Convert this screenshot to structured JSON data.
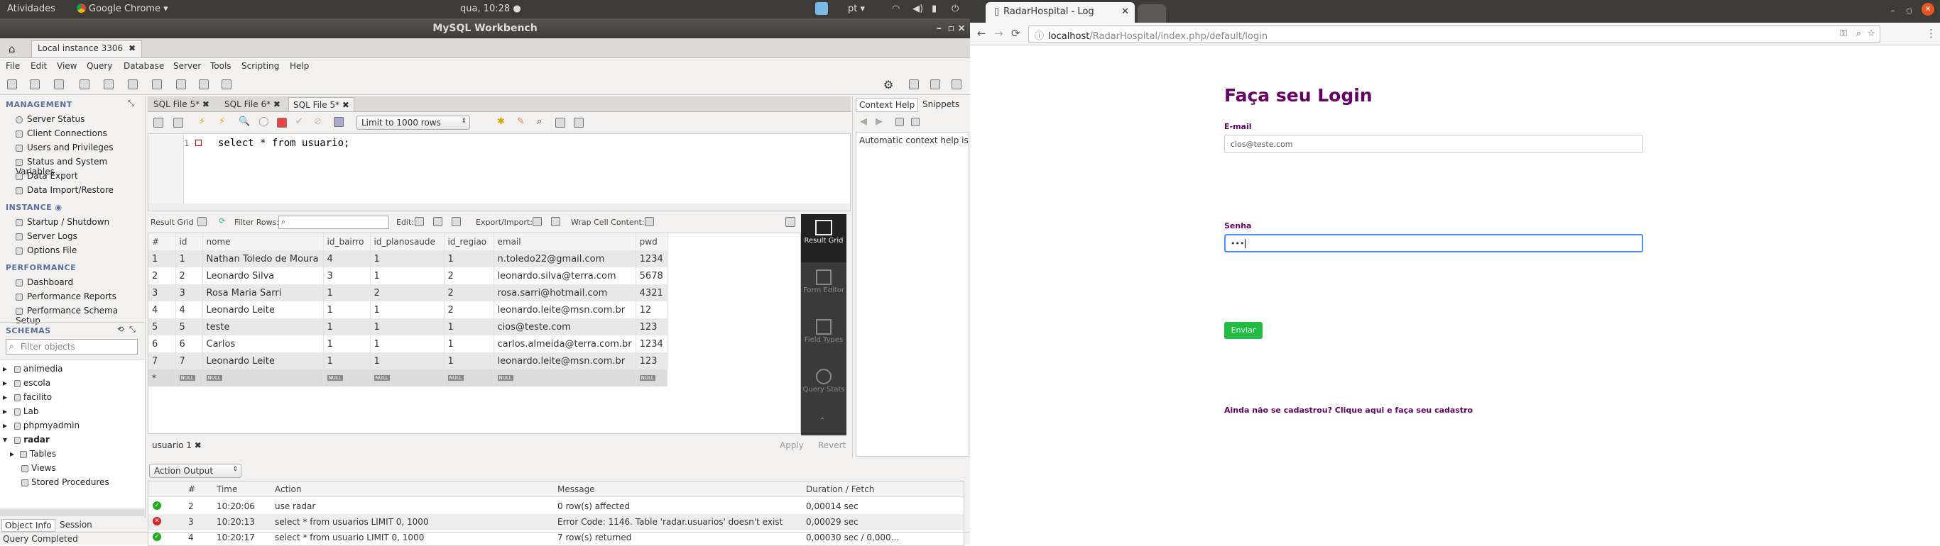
{
  "topbar": {
    "activities": "Atividades",
    "app": "Google Chrome ▾",
    "clock": "qua, 10:28 ●",
    "lang": "pt ▾"
  },
  "workbench": {
    "title": "MySQL Workbench",
    "conn_tab": "Local instance 3306",
    "menu": [
      "File",
      "Edit",
      "View",
      "Query",
      "Database",
      "Server",
      "Tools",
      "Scripting",
      "Help"
    ],
    "management": {
      "header": "MANAGEMENT",
      "items": [
        "Server Status",
        "Client Connections",
        "Users and Privileges",
        "Status and System Variables",
        "Data Export",
        "Data Import/Restore"
      ]
    },
    "instance": {
      "header": "INSTANCE",
      "items": [
        "Startup / Shutdown",
        "Server Logs",
        "Options File"
      ]
    },
    "performance": {
      "header": "PERFORMANCE",
      "items": [
        "Dashboard",
        "Performance Reports",
        "Performance Schema Setup"
      ]
    },
    "schemas": {
      "header": "SCHEMAS",
      "filter_placeholder": "Filter objects",
      "list": [
        "animedia",
        "escola",
        "facilito",
        "Lab",
        "phpmyadmin",
        "radar"
      ],
      "radar_children": [
        "Tables",
        "Views",
        "Stored Procedures"
      ]
    },
    "sql_tabs": [
      "SQL File 5*",
      "SQL File 6*",
      "SQL File 5*"
    ],
    "limit": "Limit to 1000 rows",
    "query": {
      "line": "1",
      "text": "select * from usuario;"
    },
    "result_toolbar": {
      "result_grid": "Result Grid",
      "filter_rows": "Filter Rows:",
      "edit": "Edit:",
      "export": "Export/Import:",
      "wrap": "Wrap Cell Content:"
    },
    "columns": [
      "#",
      "id",
      "nome",
      "id_bairro",
      "id_planosaude",
      "id_regiao",
      "email",
      "pwd"
    ],
    "rows": [
      [
        "1",
        "1",
        "Nathan Toledo de Moura",
        "4",
        "1",
        "1",
        "n.toledo22@gmail.com",
        "1234"
      ],
      [
        "2",
        "2",
        "Leonardo Silva",
        "3",
        "1",
        "2",
        "leonardo.silva@terra.com",
        "5678"
      ],
      [
        "3",
        "3",
        "Rosa Maria Sarri",
        "1",
        "2",
        "2",
        "rosa.sarri@hotmail.com",
        "4321"
      ],
      [
        "4",
        "4",
        "Leonardo Leite",
        "1",
        "1",
        "2",
        "leonardo.leite@msn.com.br",
        "12"
      ],
      [
        "5",
        "5",
        "teste",
        "1",
        "1",
        "1",
        "cios@teste.com",
        "123"
      ],
      [
        "6",
        "6",
        "Carlos",
        "1",
        "1",
        "1",
        "carlos.almeida@terra.com.br",
        "1234"
      ],
      [
        "7",
        "7",
        "Leonardo Leite",
        "1",
        "1",
        "1",
        "leonardo.leite@msn.com.br",
        "123"
      ]
    ],
    "null_row_marker": "*",
    "null_badge": "NULL",
    "side_tabs": [
      "Result Grid",
      "Form Editor",
      "Field Types",
      "Query Stats"
    ],
    "result_tab": "usuario 1",
    "apply": "Apply",
    "revert": "Revert",
    "context_help": {
      "tab1": "Context Help",
      "tab2": "Snippets",
      "text": "Automatic context help is"
    },
    "output": {
      "select": "Action Output",
      "columns": [
        "#",
        "Time",
        "Action",
        "Message",
        "Duration / Fetch"
      ],
      "rows": [
        {
          "status": "ok",
          "n": "2",
          "time": "10:20:06",
          "action": "use radar",
          "message": "0 row(s) affected",
          "duration": "0,00014 sec"
        },
        {
          "status": "err",
          "n": "3",
          "time": "10:20:13",
          "action": "select * from usuarios LIMIT 0, 1000",
          "message": "Error Code: 1146. Table 'radar.usuarios' doesn't exist",
          "duration": "0,00029 sec"
        },
        {
          "status": "ok",
          "n": "4",
          "time": "10:20:17",
          "action": "select * from usuario LIMIT 0, 1000",
          "message": "7 row(s) returned",
          "duration": "0,00030 sec / 0,000..."
        }
      ]
    },
    "bottom_tabs": [
      "Object Info",
      "Session"
    ],
    "status": "Query Completed"
  },
  "chrome": {
    "tab_title": "RadarHospital - Log",
    "url_host": "localhost",
    "url_path": "/RadarHospital/index.php/default/login",
    "heading": "Faça seu Login",
    "email_label": "E-mail",
    "email_value": "cios@teste.com",
    "senha_label": "Senha",
    "senha_value": "•••",
    "submit": "Enviar",
    "register": "Ainda não se cadastrou? Clique aqui e faça seu cadastro",
    "colors": {
      "purple": "#660066",
      "green": "#22bb44"
    }
  }
}
